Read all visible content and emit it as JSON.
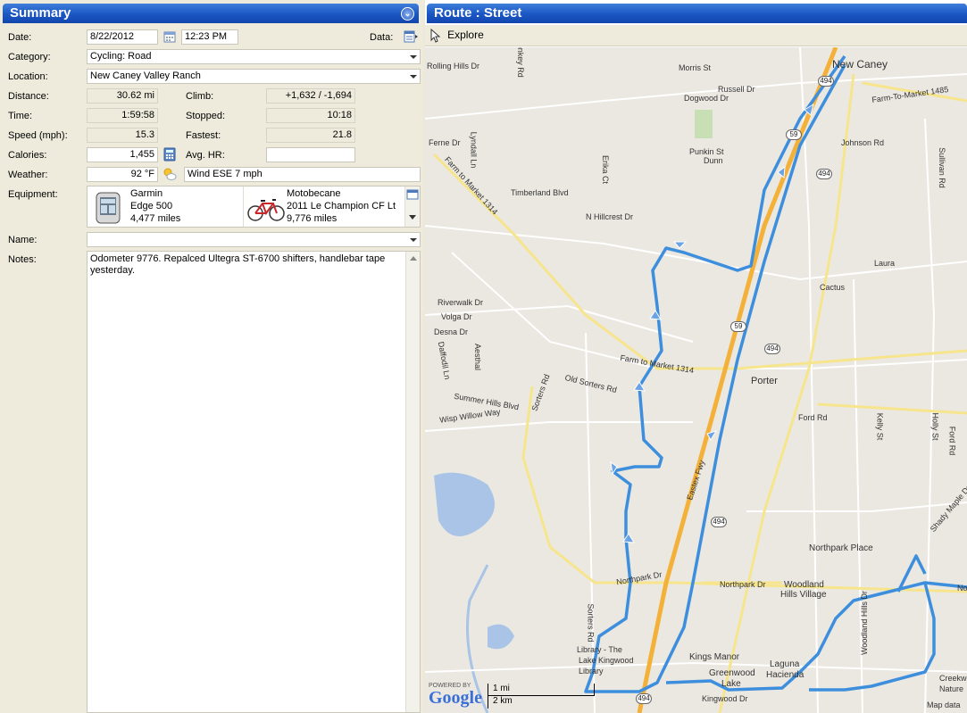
{
  "summary": {
    "title": "Summary",
    "date_label": "Date:",
    "date": "8/22/2012",
    "time_of_day": "12:23 PM",
    "data_label": "Data:",
    "category_label": "Category:",
    "category": "Cycling: Road",
    "location_label": "Location:",
    "location": "New Caney  Valley Ranch",
    "distance_label": "Distance:",
    "distance": "30.62 mi",
    "climb_label": "Climb:",
    "climb": "+1,632 / -1,694",
    "time_label": "Time:",
    "time": "1:59:58",
    "stopped_label": "Stopped:",
    "stopped": "10:18",
    "speed_label": "Speed (mph):",
    "speed": "15.3",
    "fastest_label": "Fastest:",
    "fastest": "21.8",
    "calories_label": "Calories:",
    "calories": "1,455",
    "avg_hr_label": "Avg. HR:",
    "avg_hr": "",
    "weather_label": "Weather:",
    "temperature": "92 °F",
    "wind": "Wind ESE 7 mph",
    "equipment_label": "Equipment:",
    "equipment": [
      {
        "line1": "Garmin",
        "line2": "Edge 500",
        "line3": "4,477 miles"
      },
      {
        "line1": "Motobecane",
        "line2": "2011 Le Champion  CF Lt",
        "line3": "9,776 miles"
      }
    ],
    "name_label": "Name:",
    "name": "",
    "notes_label": "Notes:",
    "notes": "Odometer 9776. Repalced Ultegra ST-6700 shifters, handlebar tape yesterday."
  },
  "route": {
    "title": "Route : Street",
    "explore_label": "Explore",
    "map_labels": [
      "New Caney",
      "Morris St",
      "Rolling Hills Dr",
      "Monkey Rd",
      "Russell Dr",
      "Dogwood Dr",
      "Farm-To-Market 1485",
      "Johnson Rd",
      "Ferne Dr",
      "Lyndall Ln",
      "Punkin St",
      "Dunn",
      "Sullivan Rd",
      "Farm to Market 1314",
      "Erika Ct",
      "Timberland Blvd",
      "N Hillcrest Dr",
      "Laura",
      "Cactus",
      "Riverwalk Dr",
      "Volga Dr",
      "Desna Dr",
      "Daffodil Ln",
      "Aesthal",
      "Farm to Market 1314",
      "Old Sorters Rd",
      "Sorters Rd",
      "Porter",
      "Summer Hills Blvd",
      "Wisp Willow Way",
      "Ford Rd",
      "Kelly St",
      "Holly St",
      "Ford Rd",
      "Eastex Fwy",
      "Shady Maple Dr",
      "Northpark Place",
      "Northpark Dr",
      "Northpark Dr",
      "Woodland",
      "Hills Village",
      "Woodland Hills Dr",
      "Sorters Rd",
      "Library - The",
      "Lake Kingwood",
      "Library",
      "Kings Manor",
      "Greenwood",
      "Lake",
      "Laguna",
      "Hacienda",
      "Kingwood Dr",
      "Creekwood",
      "Nature",
      "No"
    ],
    "shields": [
      "494",
      "494",
      "494",
      "494",
      "59",
      "59",
      "494"
    ],
    "powered_by": "POWERED BY",
    "google": "Google",
    "scale_mi": "1 mi",
    "scale_km": "2 km",
    "map_data": "Map data"
  },
  "colors": {
    "titlebar": "#1a56c4",
    "route_line": "#3d8fdd",
    "highway": "#f4b13a"
  }
}
